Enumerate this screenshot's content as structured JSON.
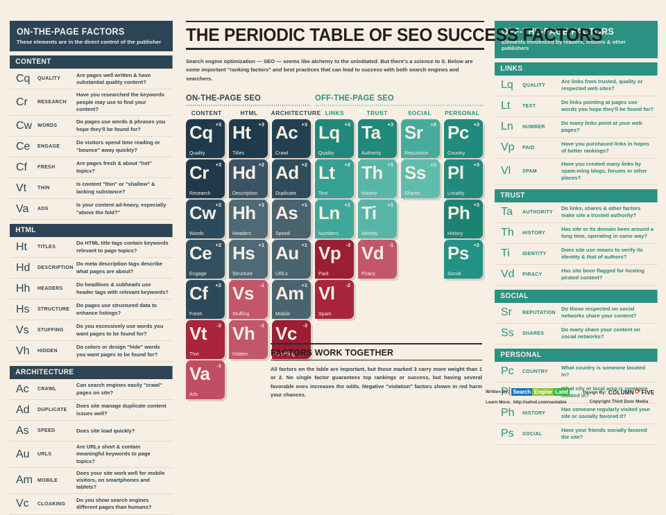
{
  "header": {
    "title": "THE PERIODIC TABLE OF SEO SUCCESS FACTORS",
    "intro": "Search engine optimization — SEO — seems like alchemy to the uninitiated. But there's a science to it. Below are some important \"ranking factors\" and best practices that can lead to success with both search engines and searchers."
  },
  "sections": {
    "on_page_label": "ON-THE-PAGE SEO",
    "off_page_label": "OFF-THE-PAGE SEO"
  },
  "column_headers": [
    {
      "label": "CONTENT",
      "tone": "navy"
    },
    {
      "label": "HTML",
      "tone": "navy"
    },
    {
      "label": "ARCHITECTURE",
      "tone": "navy"
    },
    {
      "label": "LINKS",
      "tone": "teal"
    },
    {
      "label": "TRUST",
      "tone": "teal"
    },
    {
      "label": "SOCIAL",
      "tone": "teal"
    },
    {
      "label": "PERSONAL",
      "tone": "teal"
    }
  ],
  "tiles": [
    {
      "abbr": "Cq",
      "label": "Quality",
      "weight": "+3",
      "col": 0,
      "row": 0,
      "color": "#1e3a4c"
    },
    {
      "abbr": "Cr",
      "label": "Research",
      "weight": "+3",
      "col": 0,
      "row": 1,
      "color": "#21384a"
    },
    {
      "abbr": "Cw",
      "label": "Words",
      "weight": "+2",
      "col": 0,
      "row": 2,
      "color": "#2d4a5c"
    },
    {
      "abbr": "Ce",
      "label": "Engage",
      "weight": "+2",
      "col": 0,
      "row": 3,
      "color": "#32505f"
    },
    {
      "abbr": "Cf",
      "label": "Fresh",
      "weight": "+2",
      "col": 0,
      "row": 4,
      "color": "#2d4a5c"
    },
    {
      "abbr": "Vt",
      "label": "Thin",
      "weight": "-2",
      "col": 0,
      "row": 5,
      "color": "#a8253c"
    },
    {
      "abbr": "Va",
      "label": "Ads",
      "weight": "-1",
      "col": 0,
      "row": 6,
      "color": "#c04e63"
    },
    {
      "abbr": "Ht",
      "label": "Titles",
      "weight": "+3",
      "col": 1,
      "row": 0,
      "color": "#1e3a4c"
    },
    {
      "abbr": "Hd",
      "label": "Description",
      "weight": "+2",
      "col": 1,
      "row": 1,
      "color": "#3b5464"
    },
    {
      "abbr": "Hh",
      "label": "Headers",
      "weight": "+1",
      "col": 1,
      "row": 2,
      "color": "#4f6a76"
    },
    {
      "abbr": "Hs",
      "label": "Structure",
      "weight": "+1",
      "col": 1,
      "row": 3,
      "color": "#4f6a76"
    },
    {
      "abbr": "Vs",
      "label": "Stuffing",
      "weight": "-1",
      "col": 1,
      "row": 4,
      "color": "#c2566b"
    },
    {
      "abbr": "Vh",
      "label": "Hidden",
      "weight": "-1",
      "col": 1,
      "row": 5,
      "color": "#c2566b"
    },
    {
      "abbr": "Ac",
      "label": "Crawl",
      "weight": "+3",
      "col": 2,
      "row": 0,
      "color": "#22404f"
    },
    {
      "abbr": "Ad",
      "label": "Duplicate",
      "weight": "+2",
      "col": 2,
      "row": 1,
      "color": "#2f4c5c"
    },
    {
      "abbr": "As",
      "label": "Speed",
      "weight": "+1",
      "col": 2,
      "row": 2,
      "color": "#49636f"
    },
    {
      "abbr": "Au",
      "label": "URLs",
      "weight": "+1",
      "col": 2,
      "row": 3,
      "color": "#49636f"
    },
    {
      "abbr": "Am",
      "label": "Mobile",
      "weight": "+1",
      "col": 2,
      "row": 4,
      "color": "#49636f"
    },
    {
      "abbr": "Vc",
      "label": "Cloaking",
      "weight": "-3",
      "col": 2,
      "row": 5,
      "color": "#9c1e33"
    },
    {
      "abbr": "Lq",
      "label": "Quality",
      "weight": "+3",
      "col": 3,
      "row": 0,
      "color": "#21887c"
    },
    {
      "abbr": "Lt",
      "label": "Text",
      "weight": "+2",
      "col": 3,
      "row": 1,
      "color": "#36a092"
    },
    {
      "abbr": "Ln",
      "label": "Numbers",
      "weight": "+1",
      "col": 3,
      "row": 2,
      "color": "#3fa89a"
    },
    {
      "abbr": "Vp",
      "label": "Paid",
      "weight": "-3",
      "col": 3,
      "row": 3,
      "color": "#9c1e33"
    },
    {
      "abbr": "Vl",
      "label": "Spam",
      "weight": "-2",
      "col": 3,
      "row": 4,
      "color": "#a8253c"
    },
    {
      "abbr": "Ta",
      "label": "Authority",
      "weight": "+3",
      "col": 4,
      "row": 0,
      "color": "#21887c"
    },
    {
      "abbr": "Th",
      "label": "History",
      "weight": "+1",
      "col": 4,
      "row": 1,
      "color": "#58b6a8"
    },
    {
      "abbr": "Ti",
      "label": "Identity",
      "weight": "+1",
      "col": 4,
      "row": 2,
      "color": "#58b6a8"
    },
    {
      "abbr": "Vd",
      "label": "Piracy",
      "weight": "-1",
      "col": 4,
      "row": 3,
      "color": "#c2566b"
    },
    {
      "abbr": "Sr",
      "label": "Reputation",
      "weight": "+2",
      "col": 5,
      "row": 0,
      "color": "#46ab9c"
    },
    {
      "abbr": "Ss",
      "label": "Shares",
      "weight": "+1",
      "col": 5,
      "row": 1,
      "color": "#62bcae"
    },
    {
      "abbr": "Pc",
      "label": "Country",
      "weight": "+3",
      "col": 6,
      "row": 0,
      "color": "#218a7c"
    },
    {
      "abbr": "Pl",
      "label": "Locality",
      "weight": "+3",
      "col": 6,
      "row": 1,
      "color": "#218a7c"
    },
    {
      "abbr": "Ph",
      "label": "History",
      "weight": "+3",
      "col": 6,
      "row": 2,
      "color": "#1d8274"
    },
    {
      "abbr": "Ps",
      "label": "Social",
      "weight": "+2",
      "col": 6,
      "row": 3,
      "color": "#239186"
    }
  ],
  "on_page": {
    "title": "ON-THE-PAGE FACTORS",
    "subtitle": "These elements are in the direct control of the publisher",
    "groups": [
      {
        "name": "CONTENT",
        "rows": [
          {
            "sym": "Cq",
            "name": "QUALITY",
            "desc": "Are pages well written & have substantial quality content?"
          },
          {
            "sym": "Cr",
            "name": "RESEARCH",
            "desc": "Have you researched the keywords people may use to find your content?"
          },
          {
            "sym": "Cw",
            "name": "WORDS",
            "desc": "Do pages use words & phrases you hope they'll be found for?"
          },
          {
            "sym": "Ce",
            "name": "ENGAGE",
            "desc": "Do visitors spend time reading or \"bounce\" away quickly?"
          },
          {
            "sym": "Cf",
            "name": "FRESH",
            "desc": "Are pages fresh & about \"hot\" topics?"
          },
          {
            "sym": "Vt",
            "name": "THIN",
            "desc": "Is content \"thin\" or \"shallow\" & lacking substance?"
          },
          {
            "sym": "Va",
            "name": "ADS",
            "desc": "Is your content ad-heavy, especially \"above the fold?\""
          }
        ]
      },
      {
        "name": "HTML",
        "rows": [
          {
            "sym": "Ht",
            "name": "TITLES",
            "desc": "Do HTML title tags contain keywords relevant to page topics?"
          },
          {
            "sym": "Hd",
            "name": "DESCRIPTION",
            "desc": "Do meta description tags describe what pages are about?"
          },
          {
            "sym": "Hh",
            "name": "HEADERS",
            "desc": "Do headlines & subheads use header tags with relevant keywords?"
          },
          {
            "sym": "Hs",
            "name": "STRUCTURE",
            "desc": "Do pages use structured data to enhance listings?"
          },
          {
            "sym": "Vs",
            "name": "STUFFING",
            "desc": "Do you excessively use words you want pages to be found for?"
          },
          {
            "sym": "Vh",
            "name": "HIDDEN",
            "desc": "Do colors or design \"hide\" words you want pages to be found for?"
          }
        ]
      },
      {
        "name": "ARCHITECTURE",
        "rows": [
          {
            "sym": "Ac",
            "name": "CRAWL",
            "desc": "Can search engines easily \"crawl\" pages on site?"
          },
          {
            "sym": "Ad",
            "name": "DUPLICATE",
            "desc": "Does site manage duplicate content issues well?"
          },
          {
            "sym": "As",
            "name": "SPEED",
            "desc": "Does site load quickly?"
          },
          {
            "sym": "Au",
            "name": "URLS",
            "desc": "Are URLs short & contain meaningful keywords to page topics?"
          },
          {
            "sym": "Am",
            "name": "MOBILE",
            "desc": "Does your site work well for mobile visitors, on smartphones and tablets?"
          },
          {
            "sym": "Vc",
            "name": "CLOAKING",
            "desc": "Do you show search engines different pages than humans?"
          }
        ]
      }
    ]
  },
  "off_page": {
    "title": "OFF-THE-PAGE FACTORS",
    "subtitle": "Elements influenced by readers, visitors & other publishers",
    "groups": [
      {
        "name": "LINKS",
        "rows": [
          {
            "sym": "Lq",
            "name": "QUALITY",
            "desc": "Are links from trusted, quality or respected web sites?"
          },
          {
            "sym": "Lt",
            "name": "TEXT",
            "desc": "Do links pointing at pages use words you hope they'll be found for?"
          },
          {
            "sym": "Ln",
            "name": "NUMBER",
            "desc": "Do many links point at your web pages?"
          },
          {
            "sym": "Vp",
            "name": "PAID",
            "desc": "Have you purchased links in hopes of better rankings?"
          },
          {
            "sym": "Vl",
            "name": "SPAM",
            "desc": "Have you created many links by spam-ming blogs, forums or other places?"
          }
        ]
      },
      {
        "name": "TRUST",
        "rows": [
          {
            "sym": "Ta",
            "name": "AUTHORITY",
            "desc": "Do links, shares & other factors make site a trusted authority?"
          },
          {
            "sym": "Th",
            "name": "HISTORY",
            "desc": "Has site or its domain been around a long time, operating in same way?"
          },
          {
            "sym": "Ti",
            "name": "IDENTITY",
            "desc": "Does site use means to verify its identity & that of authors?"
          },
          {
            "sym": "Vd",
            "name": "PIRACY",
            "desc": "Has site been flagged for hosting pirated content?"
          }
        ]
      },
      {
        "name": "SOCIAL",
        "rows": [
          {
            "sym": "Sr",
            "name": "REPUTATION",
            "desc": "Do those respected on social networks share your content?"
          },
          {
            "sym": "Ss",
            "name": "SHARES",
            "desc": "Do many share your content on social networks?"
          }
        ]
      },
      {
        "name": "PERSONAL",
        "rows": [
          {
            "sym": "Pc",
            "name": "COUNTRY",
            "desc": "What country is someone located in?"
          },
          {
            "sym": "Pl",
            "name": "LOCALITY",
            "desc": "What city or local area is someone located in?"
          },
          {
            "sym": "Ph",
            "name": "HISTORY",
            "desc": "Has someone regularly visited your site or socially favored it?"
          },
          {
            "sym": "Ps",
            "name": "SOCIAL",
            "desc": "Have your friends socially favored the site?"
          }
        ]
      }
    ]
  },
  "factors_note": {
    "heading": "FACTORS WORK TOGETHER",
    "body": "All factors on the table are important, but those marked 3 carry more weight than 1 or 2. No single factor guarantees top rankings or success, but having several favorable ones increases the odds. Negative \"violation\" factors shown in red harm your chances."
  },
  "credits": {
    "written_by_label": "Written By:",
    "written_by_logo": [
      "Search",
      "Engine",
      "Land"
    ],
    "learn_more_label": "Learn More:",
    "learn_more_url": "http://selnd.com/seotable",
    "design_by_label": "Design By:",
    "design_by_logo_left": "COLUMN",
    "design_by_logo_right": "FIVE",
    "copyright": "Copyright Third Door Media"
  },
  "colors": {
    "navy": "#2b4556",
    "teal": "#2a9183",
    "red": "#a8253c",
    "bg": "#f7efe3"
  }
}
